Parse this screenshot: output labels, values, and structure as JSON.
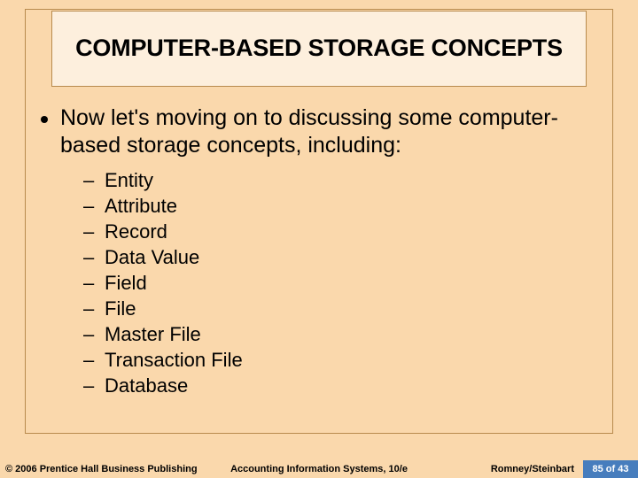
{
  "title": "COMPUTER-BASED STORAGE CONCEPTS",
  "intro": "Now let's moving on to discussing some computer-based storage concepts, including:",
  "items": [
    "Entity",
    "Attribute",
    "Record",
    "Data Value",
    "Field",
    "File",
    "Master File",
    "Transaction File",
    "Database"
  ],
  "footer": {
    "left": "© 2006 Prentice Hall Business Publishing",
    "center": "Accounting Information Systems, 10/e",
    "right": "Romney/Steinbart",
    "page": "85 of 43"
  }
}
